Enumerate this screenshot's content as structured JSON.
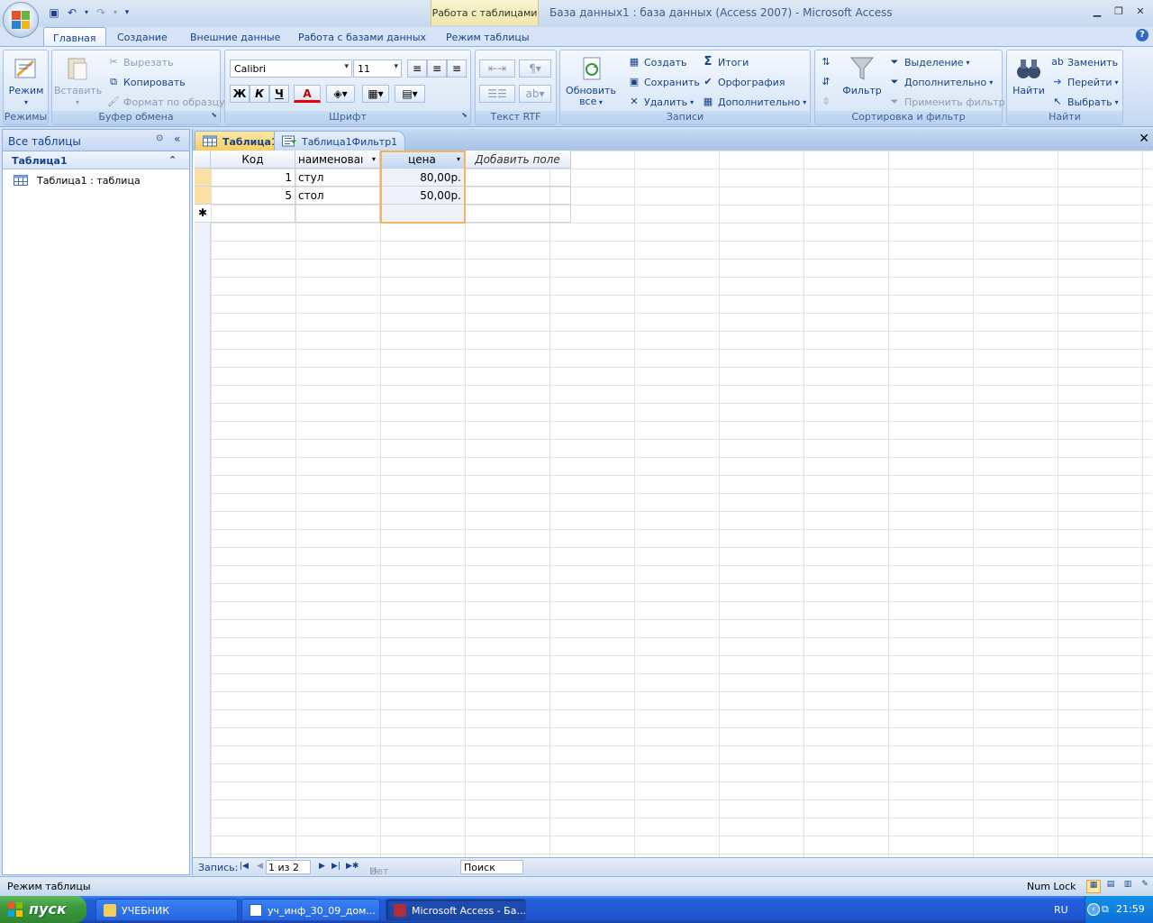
{
  "title": {
    "context_tab": "Работа с таблицами",
    "window": "База данных1 : база данных (Access 2007) - Microsoft Access"
  },
  "tabs": [
    "Главная",
    "Создание",
    "Внешние данные",
    "Работа с базами данных",
    "Режим таблицы"
  ],
  "ribbon": {
    "views": {
      "btn": "Режим",
      "label": "Режимы"
    },
    "clipboard": {
      "paste": "Вставить",
      "cut": "Вырезать",
      "copy": "Копировать",
      "format": "Формат по образцу",
      "label": "Буфер обмена"
    },
    "font": {
      "name": "Calibri",
      "size": "11",
      "bold": "Ж",
      "italic": "К",
      "underline": "Ч",
      "color": "A",
      "label": "Шрифт"
    },
    "rtf": {
      "label": "Текст RTF"
    },
    "records": {
      "refresh": "Обновить",
      "refresh2": "все",
      "new": "Создать",
      "save": "Сохранить",
      "delete": "Удалить",
      "totals": "Итоги",
      "spelling": "Орфография",
      "more": "Дополнительно",
      "label": "Записи"
    },
    "sort": {
      "filter": "Фильтр",
      "selection": "Выделение",
      "advanced": "Дополнительно",
      "apply": "Применить фильтр",
      "label": "Сортировка и фильтр"
    },
    "find": {
      "find": "Найти",
      "replace": "Заменить",
      "goto": "Перейти",
      "select": "Выбрать",
      "label": "Найти"
    },
    "colors": {
      "accent": "#15428b",
      "selected_col": "#f5b55a",
      "active_tab": "#f9cd5c"
    }
  },
  "navpane": {
    "header": "Все таблицы",
    "group": "Таблица1",
    "item": "Таблица1 : таблица"
  },
  "doctabs": [
    "Таблица1",
    "Таблица1Фильтр1"
  ],
  "datasheet": {
    "columns": [
      "Код",
      "наименоваı",
      "цена",
      "Добавить поле"
    ],
    "rows": [
      {
        "id": "1",
        "name": "стул",
        "price": "80,00р."
      },
      {
        "id": "5",
        "name": "стол",
        "price": "50,00р."
      }
    ],
    "new_marker": "✱"
  },
  "recnav": {
    "label": "Запись:",
    "position": "1 из 2",
    "filter": "Нет фильтра",
    "search": "Поиск"
  },
  "status": {
    "left": "Режим таблицы",
    "numlock": "Num Lock"
  },
  "taskbar": {
    "start": "пуск",
    "items": [
      "УЧЕБНИК",
      "уч_инф_30_09_дом...",
      "Microsoft Access - Ба..."
    ],
    "lang": "RU",
    "time": "21:59"
  }
}
